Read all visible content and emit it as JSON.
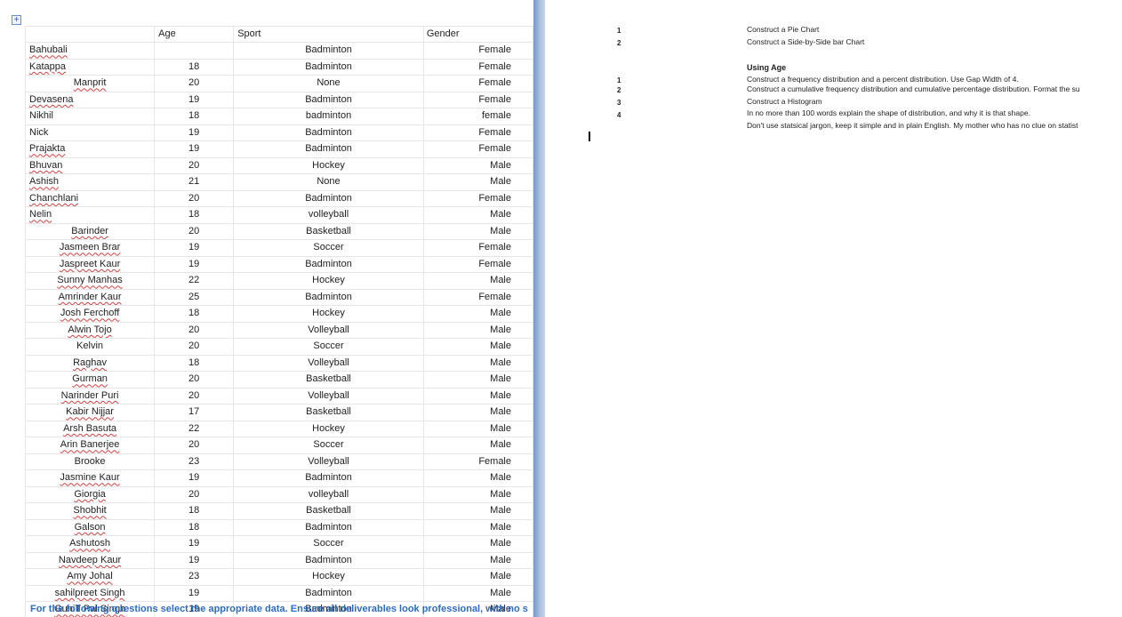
{
  "table": {
    "headers": {
      "name": "",
      "age": "Age",
      "sport": "Sport",
      "gender": "Gender"
    },
    "rows": [
      {
        "name": "Bahubali",
        "age": "",
        "sport": "Badminton",
        "gender": "Female"
      },
      {
        "name": "Katappa",
        "age": "18",
        "sport": "Badminton",
        "gender": "Female"
      },
      {
        "name": "Manprit",
        "age": "20",
        "sport": "None",
        "gender": "Female"
      },
      {
        "name": "Devasena",
        "age": "19",
        "sport": "Badminton",
        "gender": "Female"
      },
      {
        "name": "Nikhil",
        "age": "18",
        "sport": "badminton",
        "gender": "female"
      },
      {
        "name": "Nick",
        "age": "19",
        "sport": "Badminton",
        "gender": "Female"
      },
      {
        "name": "Prajakta",
        "age": "19",
        "sport": "Badminton",
        "gender": "Female"
      },
      {
        "name": "Bhuvan",
        "age": "20",
        "sport": "Hockey",
        "gender": "Male"
      },
      {
        "name": "Ashish",
        "age": "21",
        "sport": "None",
        "gender": "Male"
      },
      {
        "name": "Chanchlani",
        "age": "20",
        "sport": "Badminton",
        "gender": "Female"
      },
      {
        "name": "Nelin",
        "age": "18",
        "sport": "volleyball",
        "gender": "Male"
      },
      {
        "name": "Barinder",
        "age": "20",
        "sport": "Basketball",
        "gender": "Male"
      },
      {
        "name": "Jasmeen Brar",
        "age": "19",
        "sport": "Soccer",
        "gender": "Female"
      },
      {
        "name": "Jaspreet Kaur",
        "age": "19",
        "sport": "Badminton",
        "gender": "Female"
      },
      {
        "name": "Sunny Manhas",
        "age": "22",
        "sport": "Hockey",
        "gender": "Male"
      },
      {
        "name": "Amrinder Kaur",
        "age": "25",
        "sport": "Badminton",
        "gender": "Female"
      },
      {
        "name": "Josh Ferchoff",
        "age": "18",
        "sport": "Hockey",
        "gender": "Male"
      },
      {
        "name": "Alwin Tojo",
        "age": "20",
        "sport": "Volleyball",
        "gender": "Male"
      },
      {
        "name": "Kelvin",
        "age": "20",
        "sport": "Soccer",
        "gender": "Male"
      },
      {
        "name": "Raghav",
        "age": "18",
        "sport": "Volleyball",
        "gender": "Male"
      },
      {
        "name": "Gurman",
        "age": "20",
        "sport": "Basketball",
        "gender": "Male"
      },
      {
        "name": "Narinder Puri",
        "age": "20",
        "sport": "Volleyball",
        "gender": "Male"
      },
      {
        "name": "Kabir Nijjar",
        "age": "17",
        "sport": "Basketball",
        "gender": "Male"
      },
      {
        "name": "Arsh Basuta",
        "age": "22",
        "sport": "Hockey",
        "gender": "Male"
      },
      {
        "name": "Arin Banerjee",
        "age": "20",
        "sport": "Soccer",
        "gender": "Male"
      },
      {
        "name": "Brooke",
        "age": "23",
        "sport": "Volleyball",
        "gender": "Female"
      },
      {
        "name": "Jasmine Kaur",
        "age": "19",
        "sport": "Badminton",
        "gender": "Male"
      },
      {
        "name": "Giorgia",
        "age": "20",
        "sport": "volleyball",
        "gender": "Male"
      },
      {
        "name": "Shobhit",
        "age": "18",
        "sport": "Basketball",
        "gender": "Male"
      },
      {
        "name": "Galson",
        "age": "18",
        "sport": "Badminton",
        "gender": "Male"
      },
      {
        "name": "Ashutosh",
        "age": "19",
        "sport": "Soccer",
        "gender": "Male"
      },
      {
        "name": "Navdeep Kaur",
        "age": "19",
        "sport": "Badminton",
        "gender": "Male"
      },
      {
        "name": "Amy Johal",
        "age": "23",
        "sport": "Hockey",
        "gender": "Male"
      },
      {
        "name": "sahilpreet Singh",
        "age": "19",
        "sport": "Badminton",
        "gender": "Male"
      },
      {
        "name": "GuniT Pal Singh",
        "age": "19",
        "sport": "Badminton",
        "gender": "Male"
      }
    ]
  },
  "bottom_note": "For the following questions select the appropriate data. Ensure all deliverables look professional, with no s",
  "questions": {
    "part1": [
      {
        "num": "1",
        "text": "Construct a Pie Chart"
      },
      {
        "num": "2",
        "text": "Construct a Side-by-Side bar Chart"
      }
    ],
    "part2_heading": "Using Age",
    "part2": [
      {
        "num": "1",
        "text": "Construct a frequency distribution and a percent distribution. Use Gap Width of 4."
      },
      {
        "num": "2",
        "text": "Construct a cumulative frequency distribution and cumulative percentage distribution. Format the su"
      },
      {
        "num": "3",
        "text": "Construct a Histogram"
      },
      {
        "num": "4",
        "text": "In no more than 100 words explain the shape of distribution, and why it is that shape."
      }
    ],
    "note": "Don't use statsical jargon, keep it simple and in plain English. My mother who has no clue on statist"
  }
}
